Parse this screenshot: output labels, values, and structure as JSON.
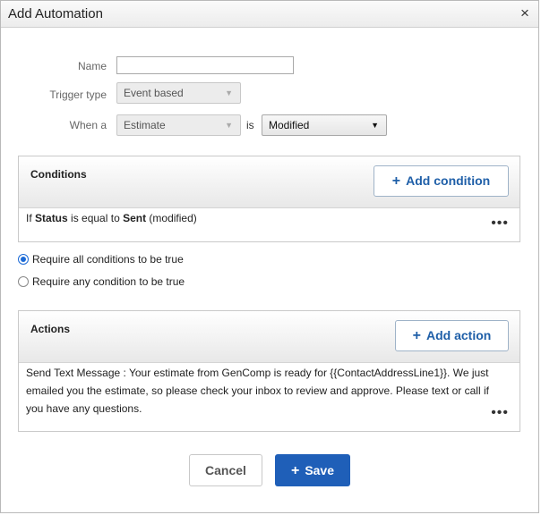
{
  "dialog": {
    "title": "Add Automation",
    "close_glyph": "×"
  },
  "form": {
    "name_label": "Name",
    "name_value": "",
    "trigger_label": "Trigger type",
    "trigger_value": "Event based",
    "when_label": "When a",
    "when_entity": "Estimate",
    "is_label": "is",
    "event_value": "Modified"
  },
  "conditions": {
    "title": "Conditions",
    "add_label": "Add condition",
    "items": [
      {
        "prefix": "If ",
        "field": "Status",
        "middle": " is equal to ",
        "value": "Sent",
        "suffix": " (modified)"
      }
    ]
  },
  "radios": {
    "all_label": "Require all conditions to be true",
    "any_label": "Require any condition to be true",
    "selected": "all"
  },
  "actions": {
    "title": "Actions",
    "add_label": "Add action",
    "items": [
      {
        "text": "Send Text Message : Your estimate from GenComp is ready for {{ContactAddressLine1}}. We just emailed you the estimate, so please check your inbox to review and approve. Please text or call if you have any questions."
      }
    ]
  },
  "footer": {
    "cancel_label": "Cancel",
    "save_label": "Save"
  },
  "icons": {
    "plus": "+",
    "more": "•••",
    "dropdown": "▼"
  },
  "colors": {
    "primary": "#1f5fb8",
    "link": "#1f5fa8",
    "radio": "#1c6ad6"
  }
}
